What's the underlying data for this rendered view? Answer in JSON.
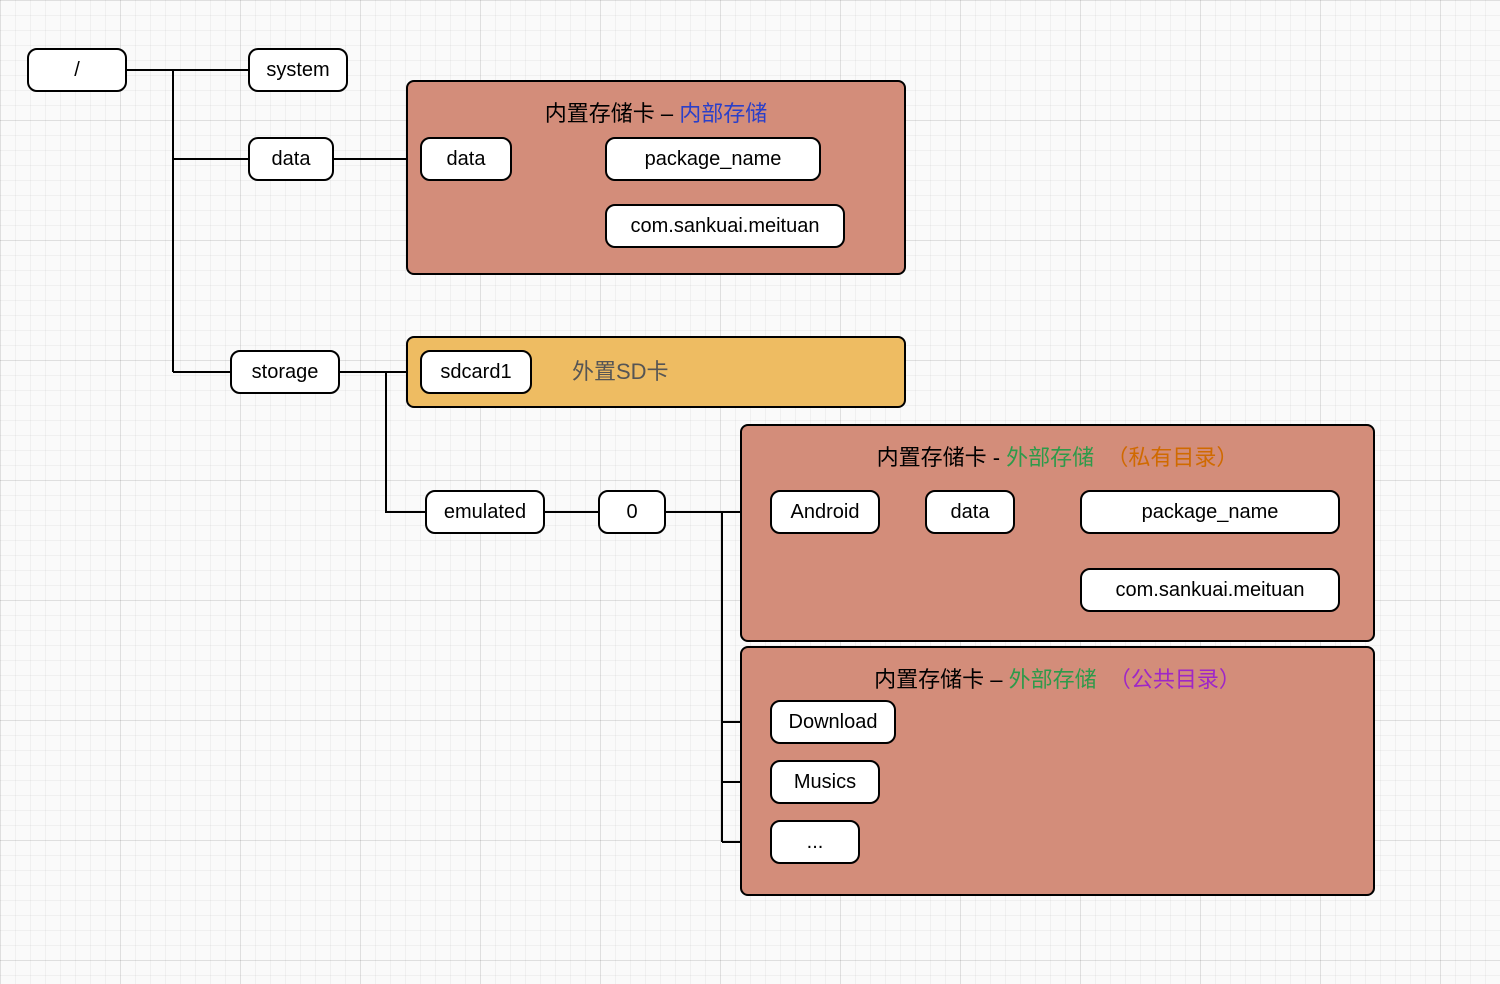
{
  "nodes": {
    "root": "/",
    "system": "system",
    "data1": "data",
    "data2": "data",
    "pkg1": "package_name",
    "com1": "com.sankuai.meituan",
    "storage": "storage",
    "sdcard1": "sdcard1",
    "emulated": "emulated",
    "zero": "0",
    "android": "Android",
    "data3": "data",
    "pkg2": "package_name",
    "com2": "com.sankuai.meituan",
    "download": "Download",
    "musics": "Musics",
    "dots": "..."
  },
  "groups": {
    "internal": {
      "prefix": "内置存储卡",
      "sep": " – ",
      "label": "内部存储"
    },
    "sdcard": {
      "label": "外置SD卡"
    },
    "extPriv": {
      "prefix": "内置存储卡",
      "sep": " - ",
      "label": "外部存储",
      "note": "（私有目录）"
    },
    "extPub": {
      "prefix": "内置存储卡",
      "sep": " – ",
      "label": "外部存储",
      "note": "（公共目录）"
    }
  }
}
